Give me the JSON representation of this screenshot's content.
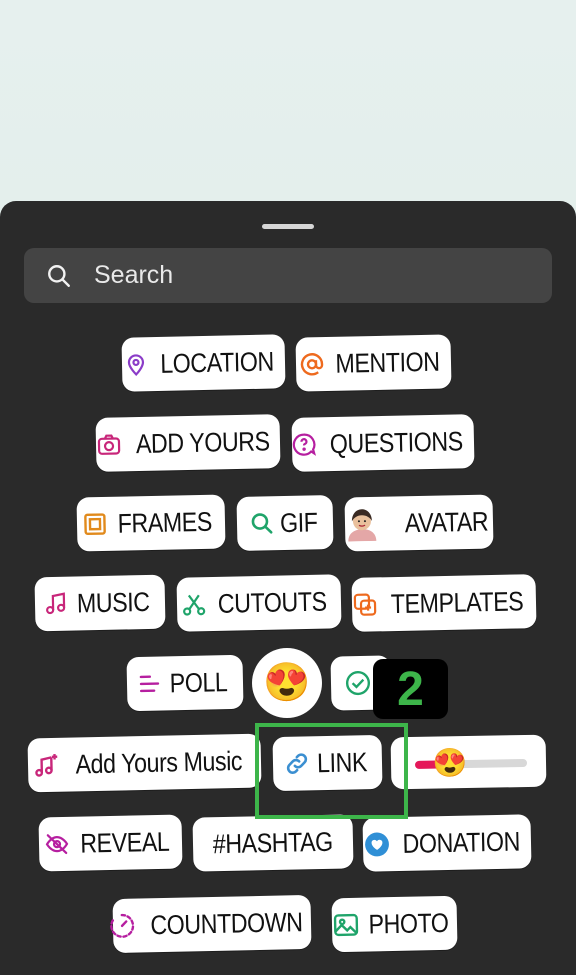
{
  "search": {
    "placeholder": "Search",
    "icon": "search-icon"
  },
  "stickers": {
    "location": "LOCATION",
    "mention": "MENTION",
    "add_yours": "ADD YOURS",
    "questions": "QUESTIONS",
    "frames": "FRAMES",
    "gif": "GIF",
    "avatar": "AVATAR",
    "music": "MUSIC",
    "cutouts": "CUTOUTS",
    "templates": "TEMPLATES",
    "poll": "POLL",
    "add_yours_music": "Add Yours Music",
    "link": "LINK",
    "reveal": "REVEAL",
    "hashtag": "#HASHTAG",
    "donation": "DONATION",
    "countdown": "COUNTDOWN",
    "photo": "PHOTO"
  },
  "emoji_slider": {
    "level": 0.3,
    "emoji": "😍"
  },
  "emoji_reaction": "😍",
  "annotation": {
    "step": "2",
    "color": "#3db54a"
  },
  "colors": {
    "sheet": "#2a2a2a",
    "search_bg": "#444444",
    "accent_green": "#3db54a"
  }
}
